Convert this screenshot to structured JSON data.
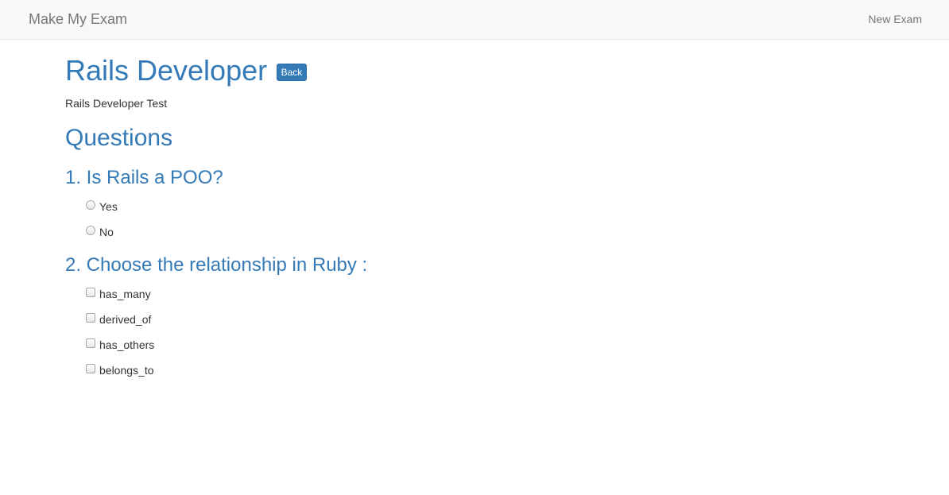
{
  "navbar": {
    "brand": "Make My Exam",
    "new_exam_link": "New Exam"
  },
  "exam": {
    "title": "Rails Developer",
    "back_label": "Back",
    "description": "Rails Developer Test"
  },
  "questions_heading": "Questions",
  "questions": [
    {
      "title": "1. Is Rails a POO?",
      "input_type": "radio",
      "options": [
        {
          "label": "Yes",
          "checked": false
        },
        {
          "label": "No",
          "checked": false
        }
      ]
    },
    {
      "title": "2. Choose the relationship in Ruby :",
      "input_type": "checkbox",
      "options": [
        {
          "label": "has_many",
          "checked": false
        },
        {
          "label": "derived_of",
          "checked": false
        },
        {
          "label": "has_others",
          "checked": false
        },
        {
          "label": "belongs_to",
          "checked": false
        }
      ]
    }
  ],
  "colors": {
    "primary": "#337ab7",
    "navbar_bg": "#f8f8f8",
    "nav_text": "#777777",
    "body_text": "#333333"
  }
}
